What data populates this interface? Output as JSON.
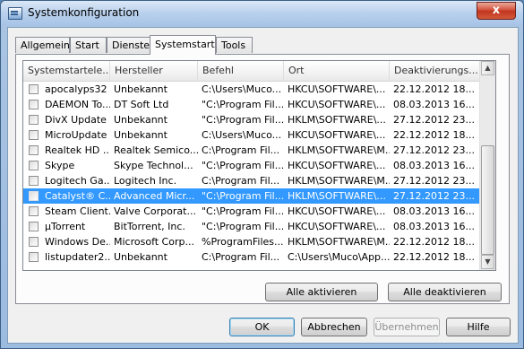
{
  "window": {
    "title": "Systemkonfiguration",
    "close_symbol": "x"
  },
  "tabs": [
    {
      "label": "Allgemein"
    },
    {
      "label": "Start"
    },
    {
      "label": "Dienste"
    },
    {
      "label": "Systemstart"
    },
    {
      "label": "Tools"
    }
  ],
  "active_tab": "Systemstart",
  "list": {
    "columns": [
      "Systemstartele...",
      "Hersteller",
      "Befehl",
      "Ort",
      "Deaktivierungs..."
    ],
    "rows": [
      {
        "name": "apocalyps32",
        "vendor": "Unbekannt",
        "command": "C:\\Users\\Muco...",
        "location": "HKCU\\SOFTWARE\\...",
        "date": "22.12.2012 18...",
        "selected": false
      },
      {
        "name": "DAEMON To...",
        "vendor": "DT Soft Ltd",
        "command": "\"C:\\Program Fil...",
        "location": "HKCU\\SOFTWARE\\...",
        "date": "08.03.2013 16...",
        "selected": false
      },
      {
        "name": "DivX Update",
        "vendor": "Unbekannt",
        "command": "\"C:\\Program Fil...",
        "location": "HKLM\\SOFTWARE\\...",
        "date": "27.12.2012 23...",
        "selected": false
      },
      {
        "name": "MicroUpdate",
        "vendor": "Unbekannt",
        "command": "C:\\Users\\Muco...",
        "location": "HKCU\\SOFTWARE\\...",
        "date": "22.12.2012 18...",
        "selected": false
      },
      {
        "name": "Realtek HD ...",
        "vendor": "Realtek Semico...",
        "command": "C:\\Program Fil...",
        "location": "HKLM\\SOFTWARE\\M...",
        "date": "27.12.2012 23...",
        "selected": false
      },
      {
        "name": "Skype",
        "vendor": "Skype Technol...",
        "command": "\"C:\\Program Fil...",
        "location": "HKCU\\SOFTWARE\\...",
        "date": "08.03.2013 16...",
        "selected": false
      },
      {
        "name": "Logitech Ga...",
        "vendor": "Logitech Inc.",
        "command": "C:\\Program Fil...",
        "location": "HKLM\\SOFTWARE\\M...",
        "date": "27.12.2012 23...",
        "selected": false
      },
      {
        "name": "Catalyst® C...",
        "vendor": "Advanced Micr...",
        "command": "\"C:\\Program Fil...",
        "location": "HKLM\\SOFTWARE\\...",
        "date": "27.12.2012 23...",
        "selected": true
      },
      {
        "name": "Steam Client...",
        "vendor": "Valve Corporat...",
        "command": "\"C:\\Program Fil...",
        "location": "HKCU\\SOFTWARE\\...",
        "date": "08.03.2013 16...",
        "selected": false
      },
      {
        "name": "µTorrent",
        "vendor": "BitTorrent, Inc.",
        "command": "\"C:\\Program Fil...",
        "location": "HKCU\\SOFTWARE\\...",
        "date": "08.03.2013 16...",
        "selected": false
      },
      {
        "name": "Windows De...",
        "vendor": "Microsoft Corp...",
        "command": "%ProgramFiles...",
        "location": "HKLM\\SOFTWARE\\M...",
        "date": "22.12.2012 18...",
        "selected": false
      },
      {
        "name": "listupdater2....",
        "vendor": "Unbekannt",
        "command": "C:\\Program Fil...",
        "location": "C:\\Users\\Muco\\App...",
        "date": "22.12.2012 18...",
        "selected": false
      }
    ]
  },
  "buttons": {
    "enable_all": "Alle aktivieren",
    "disable_all": "Alle deaktivieren",
    "ok": "OK",
    "cancel": "Abbrechen",
    "apply": "Übernehmen",
    "help": "Hilfe"
  },
  "scroll": {
    "up_symbol": "▲",
    "down_symbol": "▼"
  },
  "colors": {
    "selection": "#3399ff",
    "close": "#c7432b"
  }
}
